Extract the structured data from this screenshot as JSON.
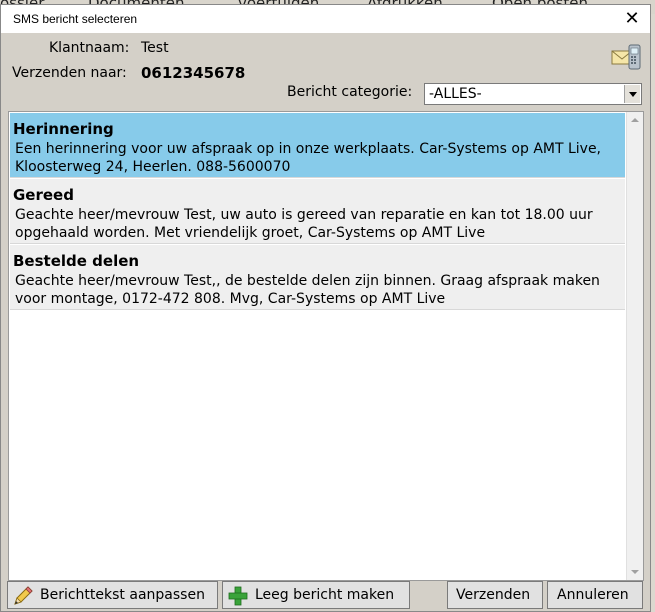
{
  "background": {
    "items": [
      "ossier",
      "Documenten",
      "voertuigen",
      "Afdrukken",
      "Open posten"
    ]
  },
  "dialog": {
    "title": "SMS bericht selecteren",
    "close_glyph": "✕"
  },
  "customer": {
    "name_label": "Klantnaam:",
    "name_value": "Test",
    "send_to_label": "Verzenden naar:",
    "send_to_value": "0612345678"
  },
  "category": {
    "label": "Bericht categorie:",
    "selected": "-ALLES-"
  },
  "messages": [
    {
      "title": "Herinnering",
      "text": "Een herinnering voor uw afspraak op  in onze werkplaats. Car-Systems op AMT Live, Kloosterweg 24, Heerlen. 088-5600070",
      "selected": true
    },
    {
      "title": "Gereed",
      "text": "Geachte heer/mevrouw Test, uw auto is gereed van reparatie en kan tot 18.00 uur opgehaald worden. Met vriendelijk groet, Car-Systems op AMT Live",
      "selected": false
    },
    {
      "title": "Bestelde delen",
      "text": "Geachte heer/mevrouw Test,, de bestelde delen zijn binnen. Graag afspraak maken voor montage, 0172-472 808. Mvg, Car-Systems op AMT Live",
      "selected": false
    }
  ],
  "buttons": {
    "edit_text": "Berichttekst aanpassen",
    "empty_message": "Leeg bericht maken",
    "send": "Verzenden",
    "cancel": "Annuleren"
  },
  "icons": {
    "mail": "sms-mail-icon",
    "edit": "pencil-icon",
    "add": "plus-icon"
  },
  "colors": {
    "selected_row": "#87cbea",
    "dialog_bg": "#d4d0c8"
  }
}
